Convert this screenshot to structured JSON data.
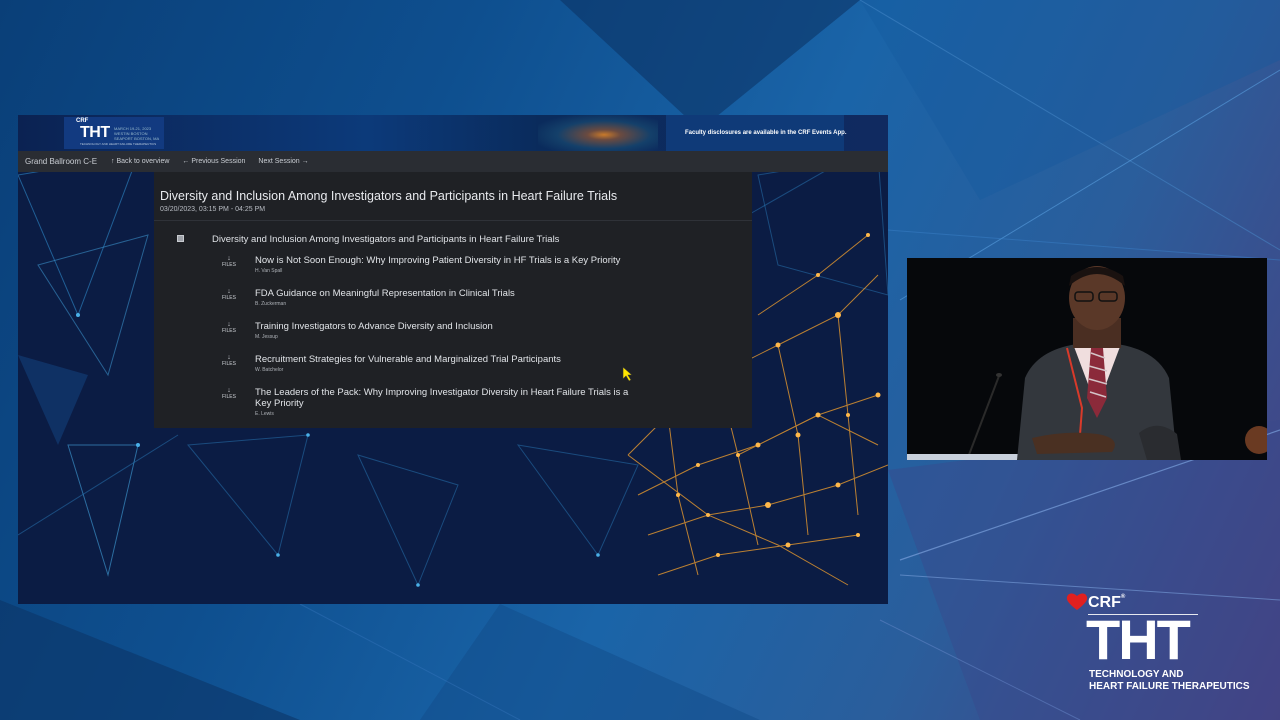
{
  "banner": {
    "brand": "CRF",
    "logo": "THT",
    "logo_subtitle": "TECHNOLOGY AND HEART FAILURE THERAPEUTICS",
    "dates": "MARCH 19-21, 2023 WESTIN BOSTON SEAPORT BOSTON, MA",
    "disclosure": "Faculty disclosures are available in the CRF Events App."
  },
  "navbar": {
    "room": "Grand Ballroom C-E",
    "back": "↑ Back to overview",
    "previous": "← Previous Session",
    "next": "Next Session →"
  },
  "session": {
    "title": "Diversity and Inclusion Among Investigators and Participants in Heart Failure Trials",
    "time": "03/20/2023, 03:15 PM - 04:25 PM",
    "parent_title": "Diversity and Inclusion Among Investigators and Participants in Heart Failure Trials",
    "files_arrow": "↓",
    "files_label": "FILES",
    "talks": [
      {
        "title": "Now is Not Soon Enough: Why Improving Patient Diversity in HF Trials is a Key Priority",
        "author": "H. Van Spall"
      },
      {
        "title": "FDA Guidance on Meaningful Representation in Clinical Trials",
        "author": "B. Zuckerman"
      },
      {
        "title": "Training Investigators to Advance Diversity and Inclusion",
        "author": "M. Jessup"
      },
      {
        "title": "Recruitment Strategies for Vulnerable and Marginalized Trial Participants",
        "author": "W. Batchelor"
      },
      {
        "title": "The Leaders of the Pack: Why Improving Investigator Diversity in Heart Failure Trials is a Key Priority",
        "author": "E. Lewis"
      }
    ]
  },
  "brand": {
    "crf": "CRF",
    "crf_reg": "®",
    "tht": "THT",
    "line1": "TECHNOLOGY AND",
    "line2": "HEART FAILURE THERAPEUTICS"
  },
  "colors": {
    "accent_red": "#e02020",
    "panel": "#1f2125",
    "navbar": "#2a2d33",
    "network_orange": "#e89a2e",
    "cursor_yellow": "#ffe600"
  }
}
